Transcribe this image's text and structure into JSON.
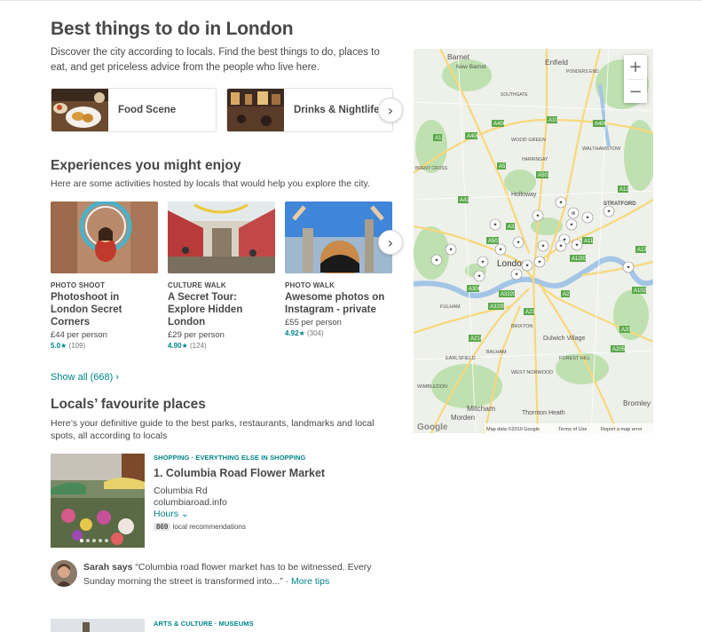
{
  "header": {
    "title": "Best things to do in London",
    "intro": "Discover the city according to locals. Find the best things to do, places to eat, and get priceless advice from the people who live here."
  },
  "categories": [
    {
      "label": "Food Scene"
    },
    {
      "label": "Drinks & Nightlife"
    }
  ],
  "experiences": {
    "title": "Experiences you might enjoy",
    "subtitle": "Here are some activities hosted by locals that would help you explore the city.",
    "show_all": "Show all (668) ›",
    "cards": [
      {
        "type": "PHOTO SHOOT",
        "title": "Photoshoot in London Secret Corners",
        "price": "£44 per person",
        "rating": "5.0",
        "reviews": "(109)"
      },
      {
        "type": "CULTURE WALK",
        "title": "A Secret Tour: Explore Hidden London",
        "price": "£29 per person",
        "rating": "4.90",
        "reviews": "(124)"
      },
      {
        "type": "PHOTO WALK",
        "title": "Awesome photos on Instagram - private",
        "price": "£55 per person",
        "rating": "4.92",
        "reviews": "(304)"
      }
    ]
  },
  "locals": {
    "title": "Locals’ favourite places",
    "subtitle": "Here’s your definitive guide to the best parks, restaurants, landmarks and local spots, all according to locals"
  },
  "place1": {
    "category": "SHOPPING · EVERYTHING ELSE IN SHOPPING",
    "title": "1. Columbia Road Flower Market",
    "address": "Columbia Rd",
    "website": "columbiaroad.info",
    "hours": "Hours ⌄",
    "rec_count": "869",
    "rec_text": "local recommendations"
  },
  "tip": {
    "author": "Sarah says",
    "text": " “Columbia road flower market has to be witnessed. Every Sunday morning the street is transformed into...” · ",
    "more": "More tips"
  },
  "place2": {
    "category": "ARTS & CULTURE · MUSEUMS"
  },
  "map": {
    "zoom_in": "+",
    "zoom_out": "−",
    "places": [
      "Barnet",
      "New Barnet",
      "Enfield",
      "PONDERS END",
      "SOUTHGATE",
      "WOOD GREEN",
      "WALTHAMSTOW",
      "HARRINGAY",
      "BRENT CROSS",
      "Holloway",
      "STRATFORD",
      "London",
      "FULHAM",
      "BRIXTON",
      "Dulwich Village",
      "EARLSFIELD",
      "BALHAM",
      "FOREST HILL",
      "WEST NORWOOD",
      "WIMBLEDON",
      "Morden",
      "Mitcham",
      "Thornton Heath",
      "Bromley"
    ],
    "roads": [
      "A406",
      "A10",
      "A1",
      "A406",
      "A5",
      "A503",
      "A41",
      "A12",
      "A501",
      "A13",
      "A11",
      "A1203",
      "A2",
      "A3220",
      "A3205",
      "A23",
      "A214",
      "A20",
      "A205",
      "A102",
      "A3",
      "A306",
      "A406"
    ],
    "google": "Google",
    "attribution": "Map data ©2019 Google",
    "terms": "Terms of Use",
    "report": "Report a map error"
  },
  "colors": {
    "accent": "#008489",
    "text": "#484848"
  }
}
